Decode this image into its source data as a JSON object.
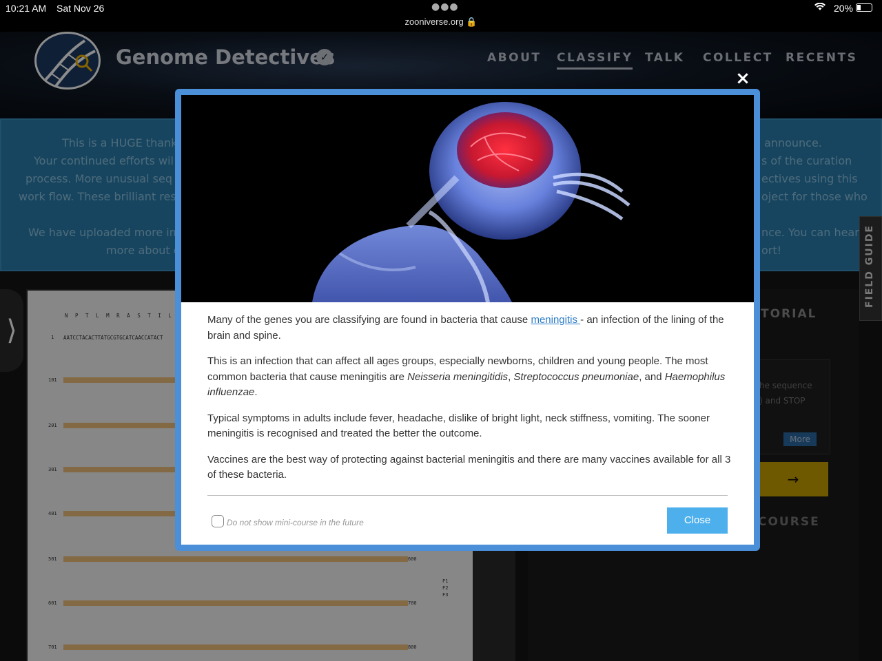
{
  "status_bar": {
    "time": "10:21 AM",
    "date": "Sat Nov 26",
    "url": "zooniverse.org 🔒",
    "battery": "20%"
  },
  "header": {
    "title": "Genome Detectives",
    "nav": [
      "ABOUT",
      "CLASSIFY",
      "TALK",
      "COLLECT",
      "RECENTS"
    ],
    "active_nav": "CLASSIFY"
  },
  "banner": {
    "left_lines": [
      "This is a HUGE thank",
      "Your continued efforts wil",
      "process. More unusual seq",
      "work flow. These brilliant res",
      "We have uploaded more im",
      "more about o"
    ],
    "right_lines": [
      "announce.",
      "s of the curation",
      "ectives using this",
      "oject for those who",
      "nce. You can hear",
      "ort!"
    ]
  },
  "side_panel": {
    "tutorial_label": "TORIAL",
    "hint_line1": "he sequence",
    "hint_line2": ") and STOP",
    "more_label": "More",
    "arrow": "→",
    "course_label": "COURSE",
    "field_guide": "FIELD GUIDE",
    "left_tab_chevron": "⟩"
  },
  "sequence": {
    "line_numbers": [
      "1",
      "101",
      "201",
      "301",
      "401",
      "501",
      "601",
      "701"
    ],
    "end_numbers": [
      "600",
      "700",
      "800"
    ],
    "frame_labels": [
      "F1",
      "F2",
      "F3"
    ],
    "first_residues": "N P T L M R A S T I L",
    "first_dna": "AATCCTACACTTATGCGTGCATCAACCATACT"
  },
  "modal": {
    "close_x": "×",
    "paragraph1_before": "Many of the genes you are classifying are found in bacteria that cause ",
    "paragraph1_link": "meningitis ",
    "paragraph1_after": "- an infection of the lining of the brain and spine.",
    "paragraph2_before": "This is an infection that can affect all ages groups, especially newborns, children and young people. The most common bacteria that cause meningitis are ",
    "paragraph2_em1": "Neisseria meningitidis",
    "paragraph2_sep1": ", ",
    "paragraph2_em2": "Streptococcus pneumoniae",
    "paragraph2_sep2": ", and ",
    "paragraph2_em3": "Haemophilus influenzae",
    "paragraph2_end": ".",
    "paragraph3": "Typical symptoms in adults include fever, headache, dislike of bright light, neck stiffness, vomiting. The sooner meningitis is recognised and treated the better the outcome.",
    "paragraph4": "Vaccines are the best way of protecting against bacterial meningitis and there are many vaccines available for all 3 of these bacteria.",
    "checkbox_label": "Do not show mini-course in the future",
    "close_button": "Close"
  }
}
